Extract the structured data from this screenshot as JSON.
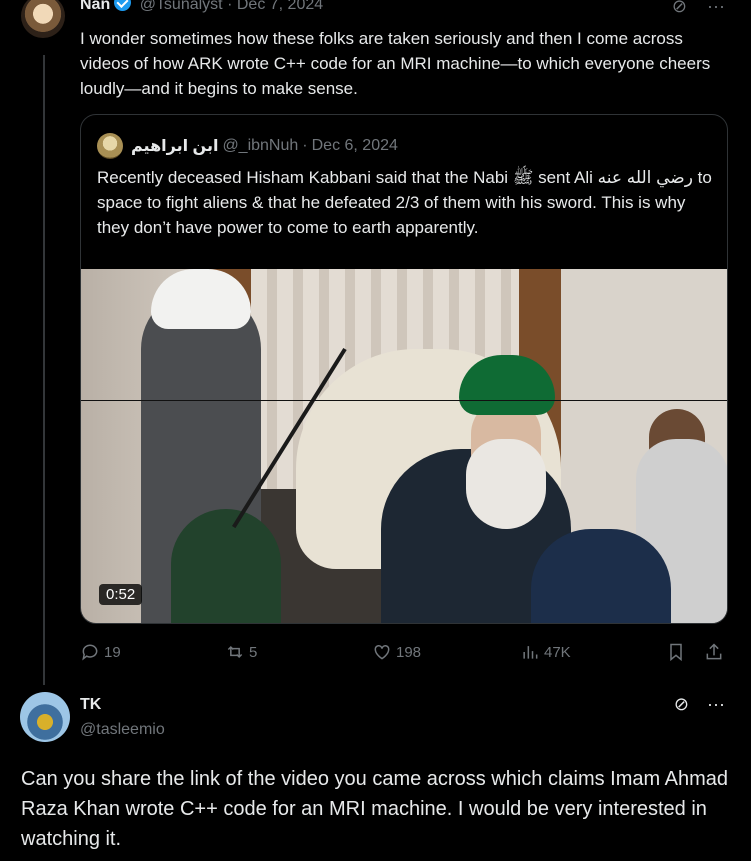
{
  "top_tweet": {
    "name": "Nan",
    "handle": "@Tsunalyst",
    "dot": "·",
    "date": "Dec 7, 2024",
    "text": "I wonder sometimes how these folks are taken seriously and then I come across videos of how ARK wrote C++ code for an MRI machine—to which everyone cheers loudly—and it begins to make sense."
  },
  "quote": {
    "name": "ابن ابراهيم",
    "handle": "@_ibnNuh",
    "dot": "·",
    "date": "Dec 6, 2024",
    "text": "Recently deceased Hisham Kabbani said that the Nabi ﷺ sent Ali رضي الله عنه to space to fight aliens & that he defeated 2/3 of them with his sword. This is why they don’t have power to come to earth apparently.",
    "video_duration": "0:52"
  },
  "actions": {
    "replies": "19",
    "reposts": "5",
    "likes": "198",
    "views": "47K"
  },
  "reply": {
    "name": "TK",
    "handle": "@tasleemio",
    "text": "Can you share the link of the video you came across which claims Imam Ahmad Raza Khan wrote C++ code for an MRI machine. I would be very interested in watching it."
  },
  "icons": {
    "more": "more-horizontal-icon",
    "grok": "grok-icon",
    "verified": "verified-badge-icon"
  },
  "colors": {
    "background": "#000000",
    "text": "#e7e9ea",
    "muted": "#71767b",
    "verified": "#1d9bf0",
    "border": "#2f3336"
  }
}
